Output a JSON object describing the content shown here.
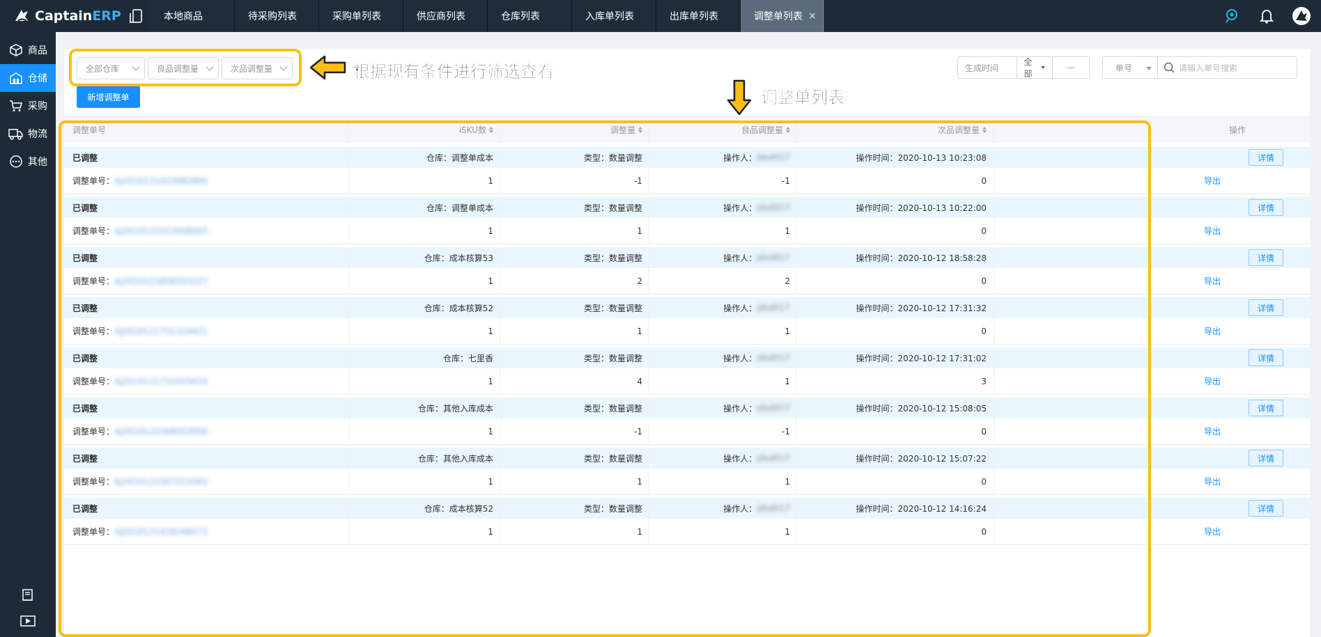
{
  "app": {
    "logo_text_1": "Captain",
    "logo_text_2": "ERP"
  },
  "tabs": [
    {
      "label": "本地商品",
      "active": false
    },
    {
      "label": "待采购列表",
      "active": false
    },
    {
      "label": "采购单列表",
      "active": false
    },
    {
      "label": "供应商列表",
      "active": false
    },
    {
      "label": "仓库列表",
      "active": false
    },
    {
      "label": "入库单列表",
      "active": false
    },
    {
      "label": "出库单列表",
      "active": false
    },
    {
      "label": "调整单列表",
      "active": true,
      "close": "×"
    }
  ],
  "sidebar": {
    "items": [
      {
        "label": "商品",
        "icon": "box-icon",
        "active": false
      },
      {
        "label": "仓储",
        "icon": "warehouse-icon",
        "active": true
      },
      {
        "label": "采购",
        "icon": "cart-icon",
        "active": false
      },
      {
        "label": "物流",
        "icon": "truck-icon",
        "active": false
      },
      {
        "label": "其他",
        "icon": "more-icon",
        "active": false
      }
    ]
  },
  "filters": {
    "warehouse": "全部仓库",
    "good_qty": "良品调整量",
    "bad_qty": "次品调整量",
    "new_button": "新增调整单",
    "date_label": "生成时间",
    "date_range": "全部",
    "date_sep": "—",
    "search_type": "单号",
    "search_placeholder": "请输入单号搜索"
  },
  "annotations": {
    "filter_hint": "根据现有条件进行筛选查看",
    "list_hint": "调整单列表"
  },
  "table": {
    "headers": {
      "order_no": "调整单号",
      "sku": "iSKU数",
      "adjust": "调整量",
      "good": "良品调整量",
      "bad": "次品调整量",
      "ops": "操作"
    },
    "detail_label": "详情",
    "export_label": "导出",
    "order_prefix": "调整单号：",
    "rows": [
      {
        "status": "已调整",
        "warehouse": "仓库：调整单成本",
        "type": "类型：数量调整",
        "operator": "操作人：",
        "operator_name": "jdsd017",
        "time": "操作时间：2020-10-13 10:23:08",
        "order_no": "AJ2010131023082800",
        "sku": "1",
        "adjust": "-1",
        "good": "-1",
        "bad": "0"
      },
      {
        "status": "已调整",
        "warehouse": "仓库：调整单成本",
        "type": "类型：数量调整",
        "operator": "操作人：",
        "operator_name": "jdsd017",
        "time": "操作时间：2020-10-13 10:22:00",
        "order_no": "AJ2010131022008003",
        "sku": "1",
        "adjust": "1",
        "good": "1",
        "bad": "0"
      },
      {
        "status": "已调整",
        "warehouse": "仓库：成本核算53",
        "type": "类型：数量调整",
        "operator": "操作人：",
        "operator_name": "jdsd017",
        "time": "操作时间：2020-10-12 18:58:28",
        "order_no": "AJ2010121858203227",
        "sku": "1",
        "adjust": "2",
        "good": "2",
        "bad": "0"
      },
      {
        "status": "已调整",
        "warehouse": "仓库：成本核算52",
        "type": "类型：数量调整",
        "operator": "操作人：",
        "operator_name": "jdsd017",
        "time": "操作时间：2020-10-12 17:31:32",
        "order_no": "AJ2010121731324421",
        "sku": "1",
        "adjust": "1",
        "good": "1",
        "bad": "0"
      },
      {
        "status": "已调整",
        "warehouse": "仓库：七里香",
        "type": "类型：数量调整",
        "operator": "操作人：",
        "operator_name": "jdsd017",
        "time": "操作时间：2020-10-12 17:31:02",
        "order_no": "AJ2010121731025619",
        "sku": "1",
        "adjust": "4",
        "good": "1",
        "bad": "3"
      },
      {
        "status": "已调整",
        "warehouse": "仓库：其他入库成本",
        "type": "类型：数量调整",
        "operator": "操作人：",
        "operator_name": "jdsd017",
        "time": "操作时间：2020-10-12 15:08:05",
        "order_no": "AJ2010121508053950",
        "sku": "1",
        "adjust": "-1",
        "good": "-1",
        "bad": "0"
      },
      {
        "status": "已调整",
        "warehouse": "仓库：其他入库成本",
        "type": "类型：数量调整",
        "operator": "操作人：",
        "operator_name": "jdsd017",
        "time": "操作时间：2020-10-12 15:07:22",
        "order_no": "AJ2010121507223393",
        "sku": "1",
        "adjust": "1",
        "good": "1",
        "bad": "0"
      },
      {
        "status": "已调整",
        "warehouse": "仓库：成本核算52",
        "type": "类型：数量调整",
        "operator": "操作人：",
        "operator_name": "jdsd017",
        "time": "操作时间：2020-10-12 14:16:24",
        "order_no": "AJ2010121416248473",
        "sku": "1",
        "adjust": "1",
        "good": "1",
        "bad": "0"
      }
    ]
  },
  "colors": {
    "accent": "#1890ff",
    "highlight": "#fbbf14",
    "nav_bg": "#1d2b38",
    "row_band": "#e9f6fd"
  }
}
